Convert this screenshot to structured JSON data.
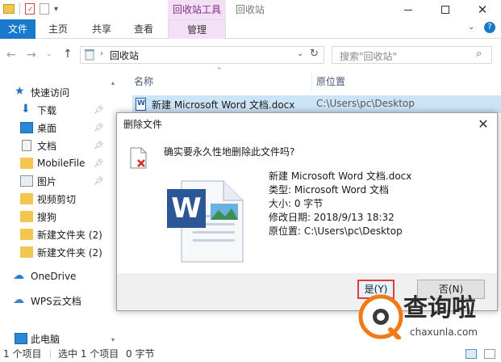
{
  "window": {
    "title": "回收站",
    "context_tab": "回收站工具"
  },
  "ribbon": {
    "tabs": [
      "文件",
      "主页",
      "共享",
      "查看",
      "管理"
    ]
  },
  "address": {
    "path": "回收站",
    "search_placeholder": "搜索\"回收站\""
  },
  "sidebar": {
    "items": [
      {
        "label": "快速访问",
        "icon": "star-icon"
      },
      {
        "label": "下载",
        "icon": "download-icon",
        "pinned": true
      },
      {
        "label": "桌面",
        "icon": "desktop-icon",
        "pinned": true
      },
      {
        "label": "文档",
        "icon": "document-icon",
        "pinned": true
      },
      {
        "label": "MobileFile",
        "icon": "folder-icon",
        "pinned": true
      },
      {
        "label": "图片",
        "icon": "picture-icon",
        "pinned": true
      },
      {
        "label": "视频剪切",
        "icon": "folder-icon"
      },
      {
        "label": "搜狗",
        "icon": "folder-icon"
      },
      {
        "label": "新建文件夹 (2)",
        "icon": "folder-icon"
      },
      {
        "label": "新建文件夹 (2)",
        "icon": "folder-icon"
      },
      {
        "label": "OneDrive",
        "icon": "cloud-icon"
      },
      {
        "label": "WPS云文档",
        "icon": "wps-cloud-icon"
      },
      {
        "label": "此电脑",
        "icon": "computer-icon"
      }
    ]
  },
  "list": {
    "columns": [
      "名称",
      "原位置"
    ],
    "rows": [
      {
        "name": "新建 Microsoft Word 文档.docx",
        "location": "C:\\Users\\pc\\Desktop"
      }
    ]
  },
  "dialog": {
    "title": "删除文件",
    "question": "确实要永久性地删除此文件吗?",
    "file_name": "新建 Microsoft Word 文档.docx",
    "type": "类型: Microsoft Word 文档",
    "size": "大小: 0 字节",
    "modified": "修改日期: 2018/9/13 18:32",
    "origin": "原位置: C:\\Users\\pc\\Desktop",
    "yes_label": "是(Y)",
    "no_label": "否(N)"
  },
  "status": {
    "count": "1 个项目",
    "selected": "选中 1 个项目",
    "size": "0 字节"
  },
  "watermark": {
    "brand": "查询啦",
    "url": "chaxunla.com"
  },
  "colors": {
    "file_tab": "#1979ca",
    "context_tab_bg": "#f4e0f6",
    "selection": "#cce4f7",
    "yes_border": "#e23b3b",
    "watermark_orange": "#f07a1a"
  }
}
